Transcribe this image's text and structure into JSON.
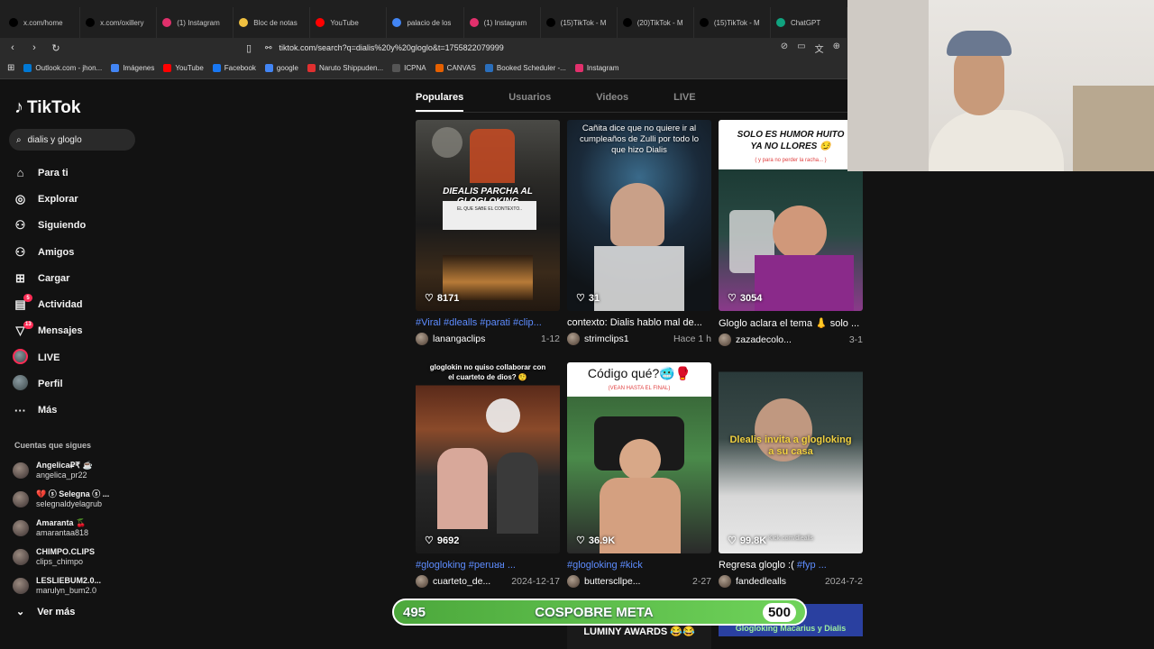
{
  "browser": {
    "tabs": [
      {
        "label": "x.com/home",
        "icon": "x-icon",
        "color": "#000000"
      },
      {
        "label": "x.com/oxillery",
        "icon": "x-icon",
        "color": "#000000"
      },
      {
        "label": "(1) Instagram",
        "icon": "instagram-icon",
        "color": "#e1306c"
      },
      {
        "label": "Bloc de notas",
        "icon": "notepad-icon",
        "color": "#f0c040"
      },
      {
        "label": "YouTube",
        "icon": "youtube-icon",
        "color": "#ff0000"
      },
      {
        "label": "palacio de los",
        "icon": "google-icon",
        "color": "#4285f4"
      },
      {
        "label": "(1) Instagram",
        "icon": "instagram-icon",
        "color": "#e1306c"
      },
      {
        "label": "(15)TikTok - M",
        "icon": "tiktok-icon",
        "color": "#000000"
      },
      {
        "label": "(20)TikTok - M",
        "icon": "tiktok-icon",
        "color": "#000000"
      },
      {
        "label": "(15)TikTok - M",
        "icon": "tiktok-icon",
        "color": "#000000"
      },
      {
        "label": "ChatGPT",
        "icon": "chatgpt-icon",
        "color": "#10a37f"
      }
    ],
    "url": "tiktok.com/search?q=dialis%20y%20gloglo&t=1755822079999",
    "bookmarks": [
      {
        "label": "Outlook.com - jhon...",
        "color": "#0078d4"
      },
      {
        "label": "Imágenes",
        "color": "#4285f4"
      },
      {
        "label": "YouTube",
        "color": "#ff0000"
      },
      {
        "label": "Facebook",
        "color": "#1877f2"
      },
      {
        "label": "google",
        "color": "#4285f4"
      },
      {
        "label": "Naruto Shippuden...",
        "color": "#e03030"
      },
      {
        "label": "ICPNA",
        "color": "#555555"
      },
      {
        "label": "CANVAS",
        "color": "#e66000"
      },
      {
        "label": "Booked Scheduler -...",
        "color": "#2a6ebb"
      },
      {
        "label": "Instagram",
        "color": "#e1306c"
      }
    ]
  },
  "sidebar": {
    "logo": "TikTok",
    "search_value": "dialis y gloglo",
    "nav": [
      {
        "label": "Para ti",
        "icon": "home-icon"
      },
      {
        "label": "Explorar",
        "icon": "compass-icon"
      },
      {
        "label": "Siguiendo",
        "icon": "following-icon"
      },
      {
        "label": "Amigos",
        "icon": "friends-icon"
      },
      {
        "label": "Cargar",
        "icon": "upload-icon"
      },
      {
        "label": "Actividad",
        "icon": "activity-icon",
        "badge": "5"
      },
      {
        "label": "Mensajes",
        "icon": "messages-icon",
        "badge": "13"
      },
      {
        "label": "LIVE",
        "icon": "live-icon"
      },
      {
        "label": "Perfil",
        "icon": "profile-icon"
      },
      {
        "label": "Más",
        "icon": "more-icon"
      }
    ],
    "following_title": "Cuentas que sigues",
    "following": [
      {
        "name": "Angelica₽₹ ☕",
        "user": "angelica_pr22"
      },
      {
        "name": "💔 ⓢ Selegna ⓢ ...",
        "user": "selegnaldyelagrub"
      },
      {
        "name": "Amaranta 🍒",
        "user": "amarantaa818"
      },
      {
        "name": "CHIMPO.CLIPS",
        "user": "clips_chimpo"
      },
      {
        "name": "LESLIEBUM2.0...",
        "user": "marulyn_bum2.0"
      }
    ],
    "ver_mas": "Ver más"
  },
  "results": {
    "tabs": [
      "Populares",
      "Usuarios",
      "Videos",
      "LIVE"
    ],
    "active_tab": "Populares",
    "videos": [
      {
        "likes": "8171",
        "overlay": "DIEALIS PARCHA AL GLOGLOKING",
        "overlay2": "EL QUE SABE EL CONTEXTO..",
        "desc_tags": "#Viral #dlealls #parati #clip...",
        "user": "lanangaclips",
        "date": "1-12"
      },
      {
        "likes": "31",
        "overlay": "Cañita dice que no quiere ir al cumpleaños de Zulli por todo lo que hizo Dialis",
        "overlay2": "",
        "desc": "contexto: Dialis hablo mal de...",
        "user": "strimclips1",
        "date": "Hace 1 h"
      },
      {
        "likes": "3054",
        "overlay": "SOLO ES HUMOR HUITO YA NO LLORES 😏",
        "overlay2": "( y para no perder la racha... )",
        "desc": "Gloglo aclara el tema 👃 solo ...",
        "user": "zazadecolo...",
        "date": "3-1"
      },
      {
        "likes": "9692",
        "overlay": "gloglokin no quiso collaborar con el cuarteto de dios? 🤨",
        "overlay2": "",
        "desc_tags": "#glogloking #peruᴚᴚ ...",
        "user": "cuarteto_de...",
        "date": "2024-12-17"
      },
      {
        "likes": "36.9K",
        "overlay": "Código qué?🥶🥊",
        "overlay2": "(VEAN HASTA EL FINAL)",
        "desc_tags": "#glogloking #kick",
        "user": "butterscllpe...",
        "date": "2-27"
      },
      {
        "likes": "99.8K",
        "overlay": "Dlealis invita a glogloking a su casa",
        "overlay2": "Kick.com/dlealls",
        "desc_pre": "Regresa gloglo :( ",
        "desc_tags": "#fyp ...",
        "user": "fandedlealls",
        "date": "2024-7-2"
      }
    ],
    "bottom_peek": "LUMINY AWARDS 😂😂",
    "bottom_peek2": "Glogloking Macarius y Dialis"
  },
  "stream_goal": {
    "current": "495",
    "label": "COSPOBRE META",
    "target": "500",
    "progress": 0.99
  }
}
